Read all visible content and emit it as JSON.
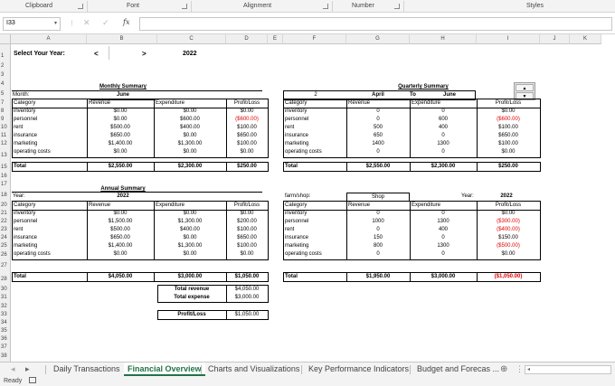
{
  "ribbon": {
    "groups": [
      "Clipboard",
      "Font",
      "Alignment",
      "Number",
      "Styles"
    ]
  },
  "formula_bar": {
    "name_box": "I33",
    "formula": "",
    "fx_label": "fx"
  },
  "columns": [
    "A",
    "B",
    "C",
    "D",
    "E",
    "F",
    "G",
    "H",
    "I",
    "J",
    "K"
  ],
  "rows": [
    "1",
    "2",
    "3",
    "4",
    "5",
    "7",
    "8",
    "9",
    "10",
    "11",
    "12",
    "13",
    "15",
    "16",
    "17",
    "18",
    "20",
    "21",
    "22",
    "23",
    "24",
    "25",
    "26",
    "27",
    "28",
    "30",
    "31",
    "32",
    "33",
    "34",
    "35",
    "36",
    "37",
    "38"
  ],
  "year_selector": {
    "label": "Select Your Year:",
    "prev": "<",
    "next": ">",
    "value": "2022"
  },
  "monthly": {
    "title": "Monthly Summary",
    "month_label": "Month:",
    "month": "June",
    "headers": [
      "Category",
      "Revenue",
      "Expenditure",
      "Profit/Loss"
    ],
    "rows": [
      [
        "inventory",
        "$0.00",
        "$0.00",
        "$0.00"
      ],
      [
        "personnel",
        "$0.00",
        "$600.00",
        "($600.00)"
      ],
      [
        "rent",
        "$500.00",
        "$400.00",
        "$100.00"
      ],
      [
        "insurance",
        "$650.00",
        "$0.00",
        "$650.00"
      ],
      [
        "marketing",
        "$1,400.00",
        "$1,300.00",
        "$100.00"
      ],
      [
        "operating costs",
        "$0.00",
        "$0.00",
        "$0.00"
      ]
    ],
    "total": [
      "Total",
      "$2,550.00",
      "$2,300.00",
      "$250.00"
    ]
  },
  "quarterly": {
    "title": "Quarterly Summary",
    "quarter": "2",
    "from": "April",
    "to_label": "To",
    "to": "June",
    "headers": [
      "Category",
      "Revenue",
      "Expenditure",
      "Profit/Loss"
    ],
    "rows": [
      [
        "inventory",
        "0",
        "0",
        "$0.00"
      ],
      [
        "personnel",
        "0",
        "600",
        "($600.00)"
      ],
      [
        "rent",
        "500",
        "400",
        "$100.00"
      ],
      [
        "insurance",
        "650",
        "0",
        "$650.00"
      ],
      [
        "marketing",
        "1400",
        "1300",
        "$100.00"
      ],
      [
        "operating costs",
        "0",
        "0",
        "$0.00"
      ]
    ],
    "total": [
      "Total",
      "$2,550.00",
      "$2,300.00",
      "$250.00"
    ]
  },
  "annual": {
    "title": "Annual Summary",
    "year_label": "Year:",
    "year": "2022",
    "headers": [
      "Category",
      "Revenue",
      "Expenditure",
      "Profit/Loss"
    ],
    "rows": [
      [
        "inventory",
        "$0.00",
        "$0.00",
        "$0.00"
      ],
      [
        "personnel",
        "$1,500.00",
        "$1,300.00",
        "$200.00"
      ],
      [
        "rent",
        "$500.00",
        "$400.00",
        "$100.00"
      ],
      [
        "insurance",
        "$650.00",
        "$0.00",
        "$650.00"
      ],
      [
        "marketing",
        "$1,400.00",
        "$1,300.00",
        "$100.00"
      ],
      [
        "operating costs",
        "$0.00",
        "$0.00",
        "$0.00"
      ]
    ],
    "total": [
      "Total",
      "$4,050.00",
      "$3,000.00",
      "$1,050.00"
    ],
    "summary": [
      [
        "Total revenue",
        "$4,050.00"
      ],
      [
        "Total expense",
        "$3,000.00"
      ],
      [
        "Profit/Loss",
        "$1,050.00"
      ]
    ]
  },
  "shop": {
    "label": "farm/shop:",
    "value": "Shop",
    "year_label": "Year:",
    "year": "2022",
    "headers": [
      "Category",
      "Revenue",
      "Expenditure",
      "Profit/Loss"
    ],
    "rows": [
      [
        "inventory",
        "0",
        "0",
        "$0.00"
      ],
      [
        "personnel",
        "1000",
        "1300",
        "($300.00)"
      ],
      [
        "rent",
        "0",
        "400",
        "($400.00)"
      ],
      [
        "insurance",
        "150",
        "0",
        "$150.00"
      ],
      [
        "marketing",
        "800",
        "1300",
        "($500.00)"
      ],
      [
        "operating costs",
        "0",
        "0",
        "$0.00"
      ]
    ],
    "total": [
      "Total",
      "$1,950.00",
      "$3,000.00",
      "($1,050.00)"
    ]
  },
  "tabs": [
    "Daily Transactions",
    "Financial Overview",
    "Charts and Visualizations",
    "Key Performance Indicators",
    "Budget and Forecas ..."
  ],
  "active_tab": "Financial Overview",
  "status": "Ready"
}
